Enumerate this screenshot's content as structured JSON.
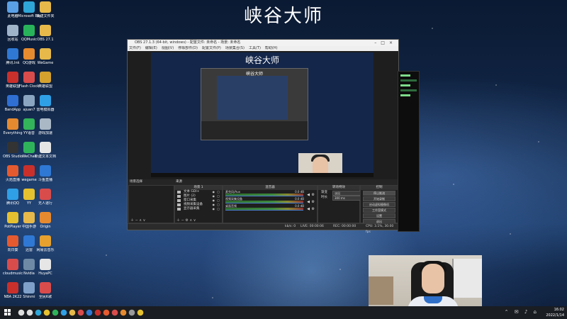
{
  "wallpaper": {
    "title": "峡谷大师"
  },
  "desktop_icons": [
    {
      "label": "此电脑",
      "color": "#5aa0e6",
      "icon": "computer-icon"
    },
    {
      "label": "Microsoft Edge",
      "color": "#2fa6d8",
      "icon": "edge-icon"
    },
    {
      "label": "新建文件夹",
      "color": "#e6b94a",
      "icon": "folder-icon"
    },
    {
      "label": "回收站",
      "color": "#9fb4c8",
      "icon": "recycle-bin-icon"
    },
    {
      "label": "QQMusic",
      "color": "#28b35a",
      "icon": "music-icon"
    },
    {
      "label": "OBS 27.1",
      "color": "#e6b94a",
      "icon": "folder-icon"
    },
    {
      "label": "腾讯.lnk",
      "color": "#2f78d4",
      "icon": "app-icon"
    },
    {
      "label": "QQ游戏",
      "color": "#e68a2f",
      "icon": "game-icon"
    },
    {
      "label": "WeGame",
      "color": "#e6b94a",
      "icon": "folder-icon"
    },
    {
      "label": "英雄联盟",
      "color": "#c9302c",
      "icon": "app-icon"
    },
    {
      "label": "Flash Clock",
      "color": "#d94c4c",
      "icon": "clock-icon"
    },
    {
      "label": "英雄联盟",
      "color": "#d4a12f",
      "icon": "app-icon"
    },
    {
      "label": "BandApp",
      "color": "#2f6fd4",
      "icon": "app-icon"
    },
    {
      "label": "ajuan7",
      "color": "#8aa5bf",
      "icon": "app-icon"
    },
    {
      "label": "雷电模拟器",
      "color": "#2fa0e6",
      "icon": "app-icon"
    },
    {
      "label": "Everything",
      "color": "#e68a2f",
      "icon": "search-icon"
    },
    {
      "label": "YY语音",
      "color": "#33b35a",
      "icon": "app-icon"
    },
    {
      "label": "游戏加速",
      "color": "#aab8c6",
      "icon": "app-icon"
    },
    {
      "label": "OBS Studio",
      "color": "#333333",
      "icon": "obs-icon"
    },
    {
      "label": "WeChat",
      "color": "#2fb35a",
      "icon": "wechat-icon"
    },
    {
      "label": "新建文本文档",
      "color": "#e6e6e6",
      "icon": "file-icon"
    },
    {
      "label": "火焰直播",
      "color": "#e65a2f",
      "icon": "app-icon"
    },
    {
      "label": "wegame",
      "color": "#c9302c",
      "icon": "app-icon"
    },
    {
      "label": "斗鱼直播",
      "color": "#2f78d4",
      "icon": "app-icon"
    },
    {
      "label": "腾讯QQ",
      "color": "#2fa0e6",
      "icon": "qq-icon"
    },
    {
      "label": "YY",
      "color": "#e6c12f",
      "icon": "app-icon"
    },
    {
      "label": "无人道行",
      "color": "#d94c4c",
      "icon": "app-icon"
    },
    {
      "label": "PotPlayer",
      "color": "#e6c12f",
      "icon": "play-icon"
    },
    {
      "label": "中国手游",
      "color": "#e6b94a",
      "icon": "app-icon"
    },
    {
      "label": "Origin",
      "color": "#e68a2f",
      "icon": "origin-icon"
    },
    {
      "label": "向日葵",
      "color": "#e65a2f",
      "icon": "app-icon"
    },
    {
      "label": "迅雷",
      "color": "#2f78d4",
      "icon": "app-icon"
    },
    {
      "label": "网易云音乐",
      "color": "#e6a12f",
      "icon": "app-icon"
    },
    {
      "label": "cloudmusic",
      "color": "#d94c4c",
      "icon": "music-icon"
    },
    {
      "label": "Nvidia",
      "color": "#6e8aa5",
      "icon": "app-icon"
    },
    {
      "label": "HuyaPC",
      "color": "#e6e6e6",
      "icon": "app-icon"
    },
    {
      "label": "NBA 2K22",
      "color": "#c9302c",
      "icon": "game-icon"
    },
    {
      "label": "Shinmi",
      "color": "#7fa0c9",
      "icon": "app-icon"
    },
    {
      "label": "全民K歌",
      "color": "#d94c4c",
      "icon": "app-icon"
    }
  ],
  "obs": {
    "title": "OBS 27.1.3 (64-bit, windows) - 配置文件: 未命名 - 场景: 未命名",
    "menu": [
      "文件(F)",
      "编辑(E)",
      "视图(V)",
      "停靠部件(D)",
      "配置文件(P)",
      "场景集合(S)",
      "工具(T)",
      "帮助(H)"
    ],
    "inner_title": "峡谷大师",
    "nest_title": "峡谷大师",
    "dock_headers": {
      "scenes": "场景选择",
      "sources": "来源",
      "mixer": "混音器",
      "transitions": "转场特效",
      "controls": "控制"
    },
    "sources_header": "场景 1",
    "sources": [
      {
        "name": "文本 GDI+"
      },
      {
        "name": "图片 (2)"
      },
      {
        "name": "窗口采集"
      },
      {
        "name": "视频采集设备"
      },
      {
        "name": "显示器采集"
      }
    ],
    "mixer": [
      {
        "name": "麦克风/Aux",
        "db": "0.0 dB"
      },
      {
        "name": "视频采集设备",
        "db": "0.0 dB"
      },
      {
        "name": "桌面音频",
        "db": "0.0 dB"
      }
    ],
    "transitions": [
      {
        "label": "渐变",
        "value": "淡出"
      },
      {
        "label": "时长",
        "value": "300 ms"
      }
    ],
    "controls": [
      {
        "label": "停止推流",
        "active": true
      },
      {
        "label": "开始录制",
        "active": false
      },
      {
        "label": "启动虚拟摄像机",
        "active": false
      },
      {
        "label": "工作室模式",
        "active": false
      },
      {
        "label": "设置",
        "active": false
      },
      {
        "label": "退出",
        "active": false
      }
    ],
    "status": {
      "live": "LIVE: 00:00:06",
      "rec": "REC: 00:00:00",
      "cpu": "CPU: 3.1%, 30.00 fps",
      "kb": "kb/s: 0"
    }
  },
  "taskbar": {
    "apps": [
      {
        "icon": "search-icon",
        "color": "#dddddd"
      },
      {
        "icon": "task-view-icon",
        "color": "#dddddd"
      },
      {
        "icon": "edge-icon",
        "color": "#2fa6d8"
      },
      {
        "icon": "chrome-icon",
        "color": "#e6c12f"
      },
      {
        "icon": "wechat-icon",
        "color": "#2fb35a"
      },
      {
        "icon": "qq-icon",
        "color": "#2fa0e6"
      },
      {
        "icon": "folder-icon",
        "color": "#e6b94a"
      },
      {
        "icon": "app-icon",
        "color": "#d94c4c"
      },
      {
        "icon": "app-icon",
        "color": "#2f78d4"
      },
      {
        "icon": "app-icon",
        "color": "#c9302c"
      },
      {
        "icon": "app-icon",
        "color": "#e65a2f"
      },
      {
        "icon": "music-icon",
        "color": "#d94c4c"
      },
      {
        "icon": "game-icon",
        "color": "#e68a2f"
      },
      {
        "icon": "obs-icon",
        "color": "#9a9a9a"
      },
      {
        "icon": "app-icon",
        "color": "#e6c12f"
      }
    ],
    "time": "16:02",
    "date": "2022/1/14"
  }
}
